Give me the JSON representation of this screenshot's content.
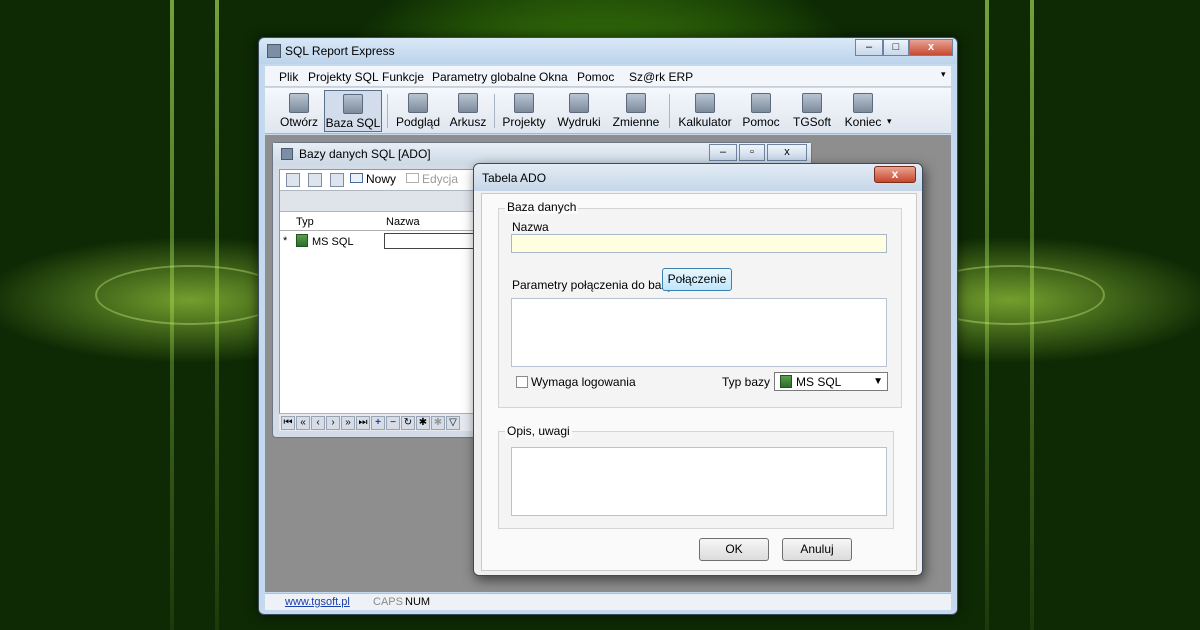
{
  "main": {
    "title": "SQL Report Express",
    "window_buttons": {
      "minimize": "–",
      "maximize": "□",
      "close": "x"
    },
    "menu": [
      "Plik",
      "Projekty SQL",
      "Funkcje",
      "Parametry globalne",
      "Okna",
      "Pomoc",
      "Sz@rk ERP"
    ],
    "toolbar": [
      {
        "label": "Otwórz",
        "icon": "open-folder-icon"
      },
      {
        "label": "Baza SQL",
        "icon": "database-icon",
        "pressed": true
      },
      {
        "label": "Podgląd",
        "icon": "preview-icon"
      },
      {
        "label": "Arkusz",
        "icon": "spreadsheet-icon"
      },
      {
        "label": "Projekty",
        "icon": "projects-icon"
      },
      {
        "label": "Wydruki",
        "icon": "printouts-icon"
      },
      {
        "label": "Zmienne",
        "icon": "variables-icon"
      },
      {
        "label": "Kalkulator",
        "icon": "calculator-icon"
      },
      {
        "label": "Pomoc",
        "icon": "help-icon"
      },
      {
        "label": "TGSoft",
        "icon": "home-icon"
      },
      {
        "label": "Koniec",
        "icon": "exit-door-icon"
      }
    ],
    "status": {
      "link": "www.tgsoft.pl",
      "caps": "CAPS",
      "num": "NUM"
    }
  },
  "child": {
    "title": "Bazy danych SQL [ADO]",
    "toolbar": {
      "new_label": "Nowy",
      "edit_label": "Edycja"
    },
    "columns": [
      "Typ",
      "Nazwa"
    ],
    "row": {
      "marker": "*",
      "type": "MS SQL"
    }
  },
  "dialog": {
    "title": "Tabela ADO",
    "close": "x",
    "group_label": "Baza danych",
    "name_label": "Nazwa",
    "name_value": "",
    "conn_label": "Parametry połączenia do bazy",
    "conn_button": "Połączenie",
    "login_label": "Wymaga logowania",
    "type_label": "Typ bazy",
    "type_value": "MS SQL",
    "notes_label": "Opis, uwagi",
    "ok": "OK",
    "cancel": "Anuluj"
  }
}
